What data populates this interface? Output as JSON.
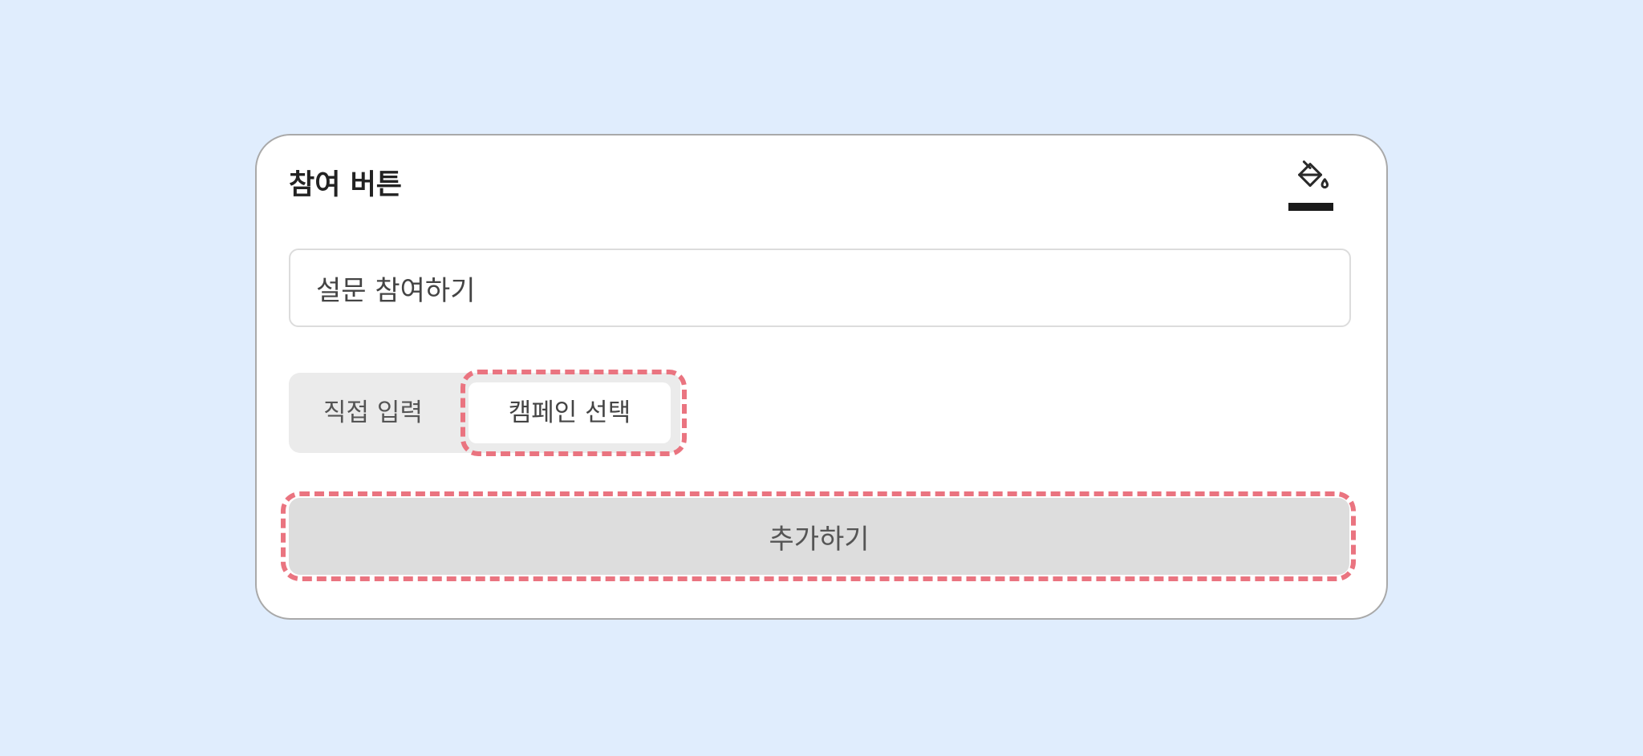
{
  "card": {
    "title": "참여 버튼"
  },
  "style_control": {
    "icon": "paint-bucket-icon",
    "swatch_color": "#1a1a1a"
  },
  "button_text_input": {
    "value": "설문 참여하기"
  },
  "link_mode": {
    "options": [
      "직접 입력",
      "캠페인 선택"
    ],
    "selected": "캠페인 선택"
  },
  "add_button": {
    "label": "추가하기"
  },
  "highlight_color": "#ea7480"
}
